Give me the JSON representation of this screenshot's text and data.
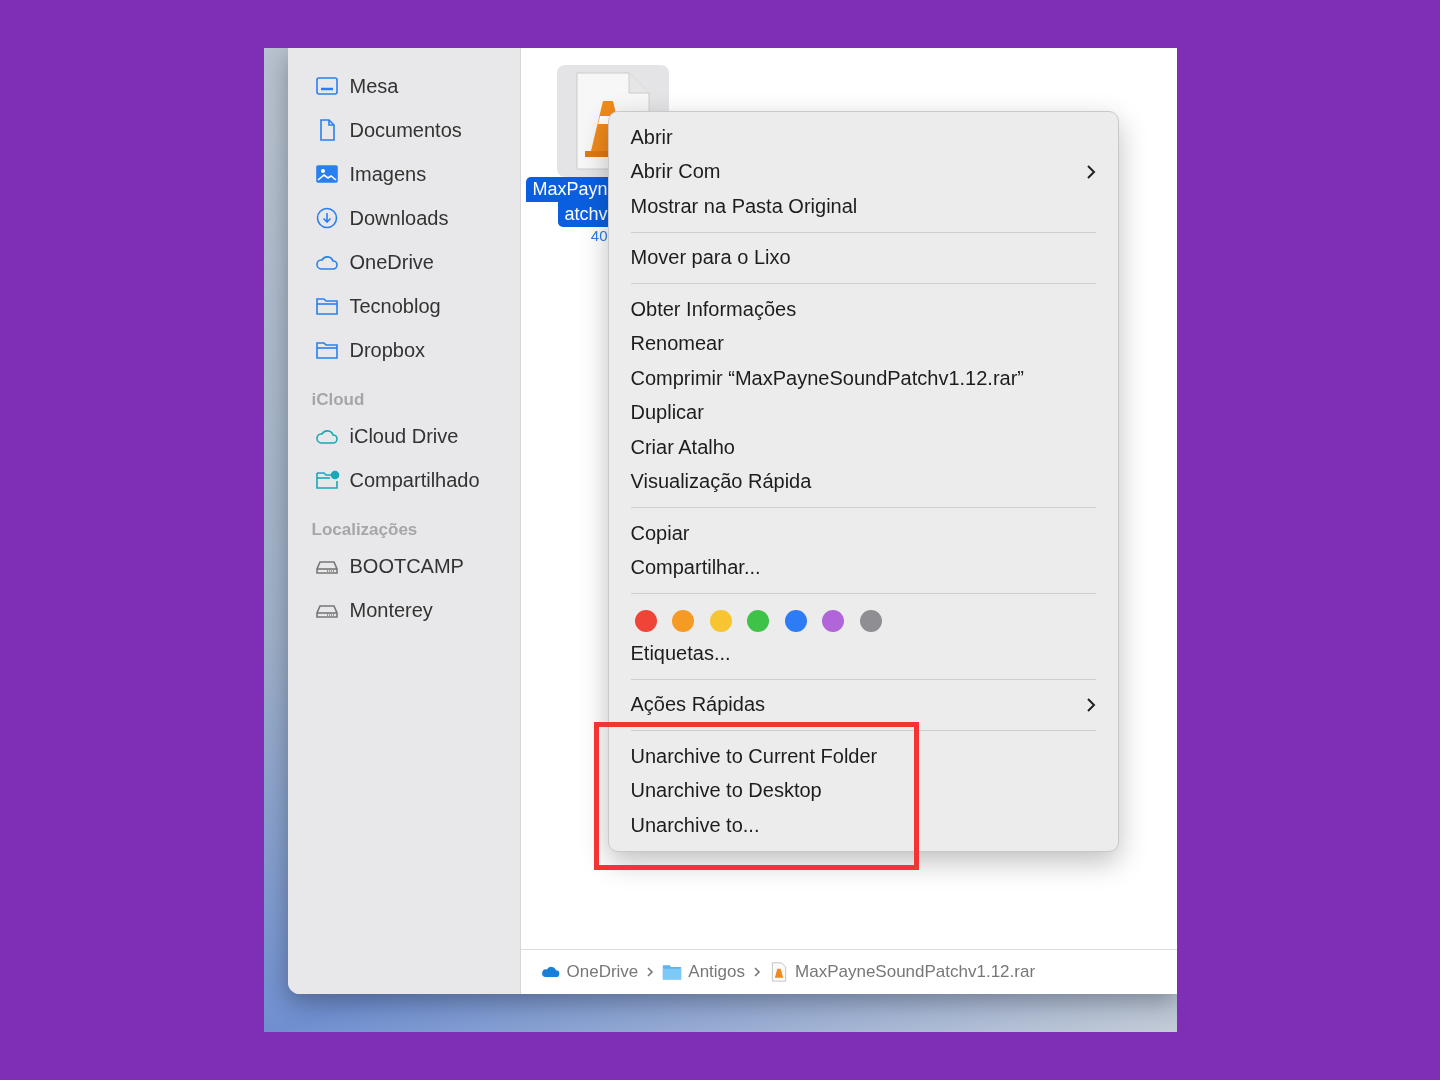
{
  "sidebar": {
    "sections": [
      {
        "items": [
          {
            "label": "Mesa",
            "kind": "desktop"
          },
          {
            "label": "Documentos",
            "kind": "document"
          },
          {
            "label": "Imagens",
            "kind": "image"
          },
          {
            "label": "Downloads",
            "kind": "download"
          },
          {
            "label": "OneDrive",
            "kind": "cloud"
          },
          {
            "label": "Tecnoblog",
            "kind": "folder"
          },
          {
            "label": "Dropbox",
            "kind": "folder"
          }
        ]
      },
      {
        "heading": "iCloud",
        "items": [
          {
            "label": "iCloud Drive",
            "kind": "cloud-teal"
          },
          {
            "label": "Compartilhado",
            "kind": "shared-folder"
          }
        ]
      },
      {
        "heading": "Localizações",
        "items": [
          {
            "label": "BOOTCAMP",
            "kind": "drive"
          },
          {
            "label": "Monterey",
            "kind": "drive"
          }
        ]
      }
    ]
  },
  "file": {
    "name_lines": [
      "MaxPayn",
      "atchv"
    ],
    "size": "40",
    "selected": true
  },
  "context_menu": {
    "groups": [
      {
        "items": [
          {
            "label": "Abrir",
            "submenu": false
          },
          {
            "label": "Abrir Com",
            "submenu": true
          },
          {
            "label": "Mostrar na Pasta Original",
            "submenu": false
          }
        ]
      },
      {
        "items": [
          {
            "label": "Mover para o Lixo",
            "submenu": false
          }
        ]
      },
      {
        "items": [
          {
            "label": "Obter Informações",
            "submenu": false
          },
          {
            "label": "Renomear",
            "submenu": false
          },
          {
            "label": "Comprimir “MaxPayneSoundPatchv1.12.rar”",
            "submenu": false
          },
          {
            "label": "Duplicar",
            "submenu": false
          },
          {
            "label": "Criar Atalho",
            "submenu": false
          },
          {
            "label": "Visualização Rápida",
            "submenu": false
          }
        ]
      },
      {
        "items": [
          {
            "label": "Copiar",
            "submenu": false
          },
          {
            "label": "Compartilhar...",
            "submenu": false
          }
        ]
      },
      {
        "tags": [
          {
            "color": "#f04438"
          },
          {
            "color": "#f59a23"
          },
          {
            "color": "#f7c531"
          },
          {
            "color": "#3ec247"
          },
          {
            "color": "#2d7cf6"
          },
          {
            "color": "#b065d8"
          },
          {
            "color": "#8e8e93"
          }
        ],
        "items": [
          {
            "label": "Etiquetas...",
            "submenu": false
          }
        ]
      },
      {
        "items": [
          {
            "label": "Ações Rápidas",
            "submenu": true
          }
        ]
      },
      {
        "highlighted": true,
        "items": [
          {
            "label": "Unarchive to Current Folder",
            "submenu": false
          },
          {
            "label": "Unarchive to Desktop",
            "submenu": false
          },
          {
            "label": "Unarchive to...",
            "submenu": false
          }
        ]
      }
    ]
  },
  "path_bar": [
    {
      "label": "OneDrive",
      "kind": "cloud"
    },
    {
      "label": "Antigos",
      "kind": "folder"
    },
    {
      "label": "MaxPayneSoundPatchv1.12.rar",
      "kind": "rar"
    }
  ]
}
